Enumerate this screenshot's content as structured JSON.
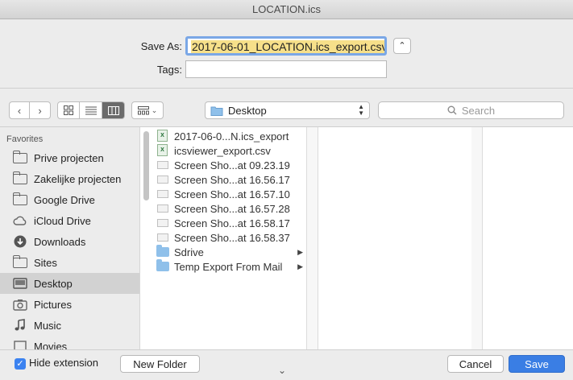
{
  "window": {
    "title": "LOCATION.ics"
  },
  "save_panel": {
    "save_as_label": "Save As:",
    "save_as_value": "2017-06-01_LOCATION.ics_export.csv",
    "tags_label": "Tags:",
    "tags_value": ""
  },
  "toolbar": {
    "location": "Desktop",
    "search_placeholder": "Search"
  },
  "sidebar": {
    "heading": "Favorites",
    "items": [
      {
        "label": "Prive projecten",
        "icon": "folder-icon"
      },
      {
        "label": "Zakelijke projecten",
        "icon": "folder-icon"
      },
      {
        "label": "Google Drive",
        "icon": "folder-icon"
      },
      {
        "label": "iCloud Drive",
        "icon": "cloud-icon"
      },
      {
        "label": "Downloads",
        "icon": "download-icon"
      },
      {
        "label": "Sites",
        "icon": "folder-icon"
      },
      {
        "label": "Desktop",
        "icon": "desktop-icon",
        "selected": true
      },
      {
        "label": "Pictures",
        "icon": "camera-icon"
      },
      {
        "label": "Music",
        "icon": "music-note-icon"
      },
      {
        "label": "Movies",
        "icon": "film-icon"
      }
    ]
  },
  "files": [
    {
      "name": "2017-06-0...N.ics_export",
      "icon": "spreadsheet-icon"
    },
    {
      "name": "icsviewer_export.csv",
      "icon": "spreadsheet-icon"
    },
    {
      "name": "Screen Sho...at 09.23.19",
      "icon": "document-icon"
    },
    {
      "name": "Screen Sho...at 16.56.17",
      "icon": "image-icon"
    },
    {
      "name": "Screen Sho...at 16.57.10",
      "icon": "image-icon"
    },
    {
      "name": "Screen Sho...at 16.57.28",
      "icon": "image-icon"
    },
    {
      "name": "Screen Sho...at 16.58.17",
      "icon": "image-icon"
    },
    {
      "name": "Screen Sho...at 16.58.37",
      "icon": "image-icon"
    },
    {
      "name": "Sdrive",
      "icon": "folder-icon",
      "has_children": true
    },
    {
      "name": "Temp Export From Mail",
      "icon": "folder-icon",
      "has_children": true
    }
  ],
  "bottom": {
    "hide_extension_label": "Hide extension",
    "hide_extension_checked": true,
    "new_folder_label": "New Folder",
    "cancel_label": "Cancel",
    "save_label": "Save"
  },
  "colors": {
    "accent": "#3a7ee4",
    "selection_highlight": "#f7e08a",
    "sidebar_selected": "#d2d2d2"
  }
}
